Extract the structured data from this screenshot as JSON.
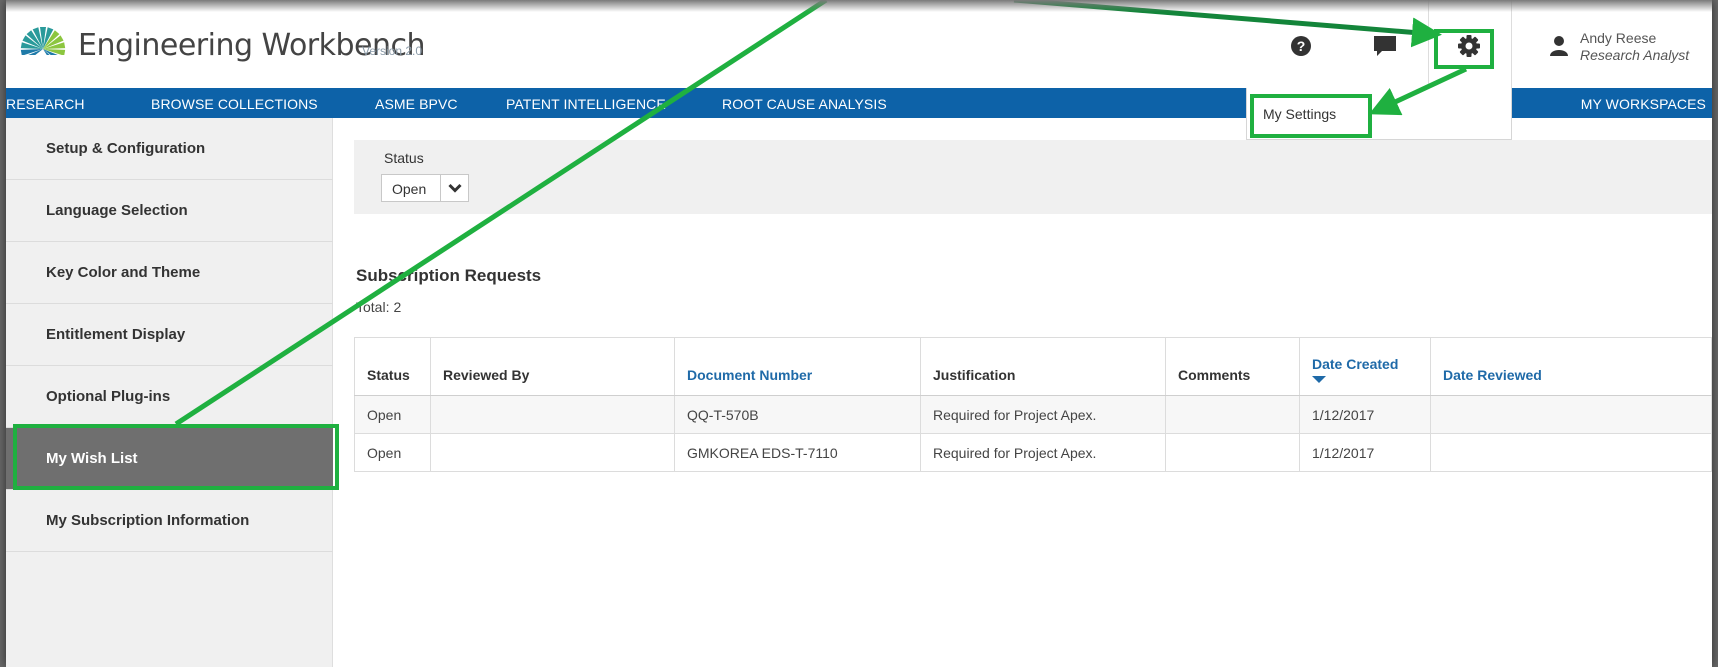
{
  "app": {
    "title": "Engineering Workbench",
    "version": "Version 2.0"
  },
  "header": {
    "icons": [
      "help-icon",
      "chat-icon",
      "gear-icon",
      "user-icon"
    ],
    "user_name": "Andy Reese",
    "user_role": "Research Analyst"
  },
  "nav": {
    "items": [
      "RESEARCH",
      "BROWSE COLLECTIONS",
      "ASME BPVC",
      "PATENT INTELLIGENCE",
      "ROOT CAUSE ANALYSIS"
    ],
    "right_item": "MY WORKSPACES"
  },
  "settings_menu": {
    "items": [
      "My Settings"
    ]
  },
  "sidebar": {
    "items": [
      {
        "label": "Setup & Configuration"
      },
      {
        "label": "Language Selection"
      },
      {
        "label": "Key Color and Theme"
      },
      {
        "label": "Entitlement Display"
      },
      {
        "label": "Optional Plug-ins"
      },
      {
        "label": "My Wish List",
        "active": true
      },
      {
        "label": "My Subscription Information"
      }
    ]
  },
  "filter": {
    "label": "Status",
    "selected": "Open"
  },
  "section": {
    "title": "Subscription Requests",
    "total_label": "Total:",
    "total_value": "2"
  },
  "table": {
    "columns": [
      "Status",
      "Reviewed By",
      "Document Number",
      "Justification",
      "Comments",
      "Date Created",
      "Date Reviewed"
    ],
    "rows": [
      [
        "Open",
        "",
        "QQ-T-570B",
        "Required for Project Apex.",
        "",
        "1/12/2017",
        ""
      ],
      [
        "Open",
        "",
        "GMKOREA EDS-T-7110",
        "Required for Project Apex.",
        "",
        "1/12/2017",
        ""
      ]
    ]
  },
  "colors": {
    "nav_blue": "#0d62a8",
    "link_blue": "#1f6aa8",
    "annotation_green": "#1fb040",
    "active_sidebar": "#6f6f6f"
  }
}
